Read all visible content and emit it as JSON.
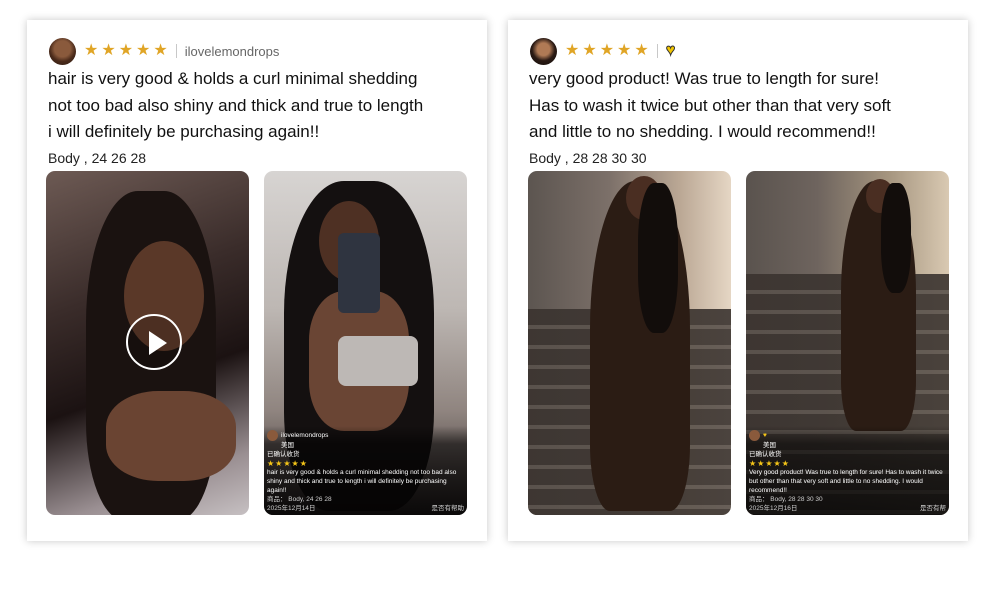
{
  "reviews": [
    {
      "username": "ilovelemondrops",
      "stars": [
        "★",
        "★",
        "★",
        "★",
        "★"
      ],
      "text_lines": [
        "hair is very good & holds a curl minimal shedding",
        "not too bad also shiny and thick and true to length",
        "i will definitely be purchasing again!!"
      ],
      "meta": "Body , 24 26 28",
      "overlay": {
        "username": "ilovelemondrops",
        "country": "美国",
        "verified": "已确认收货",
        "stars": "★★★★★",
        "text": "hair is very good & holds a curl minimal shedding not too bad also shiny and thick and true to length i will definitely be purchasing again!!",
        "product": "商品：  Body, 24 26 28",
        "date": "2025年12月14日",
        "helpful": "是否有帮助"
      }
    },
    {
      "username": "",
      "icon": "heart-icon",
      "stars": [
        "★",
        "★",
        "★",
        "★",
        "★"
      ],
      "text_lines": [
        "very good product! Was true to length for sure!",
        "Has to wash it twice but other than that very soft",
        "and little to no shedding. I would recommend!!"
      ],
      "meta": "Body , 28 28 30 30",
      "overlay": {
        "country": "美国",
        "verified": "已确认收货",
        "stars": "★★★★★",
        "text": "Very good product! Was true to length for sure! Has to wash it twice but other than that very soft and little to no shedding. I would recommend!!",
        "product": "商品：  Body, 28 28 30 30",
        "date": "2025年12月16日",
        "helpful": "是否有帮"
      }
    }
  ],
  "colors": {
    "star": "#e0a526",
    "heart": "#f2c500"
  }
}
